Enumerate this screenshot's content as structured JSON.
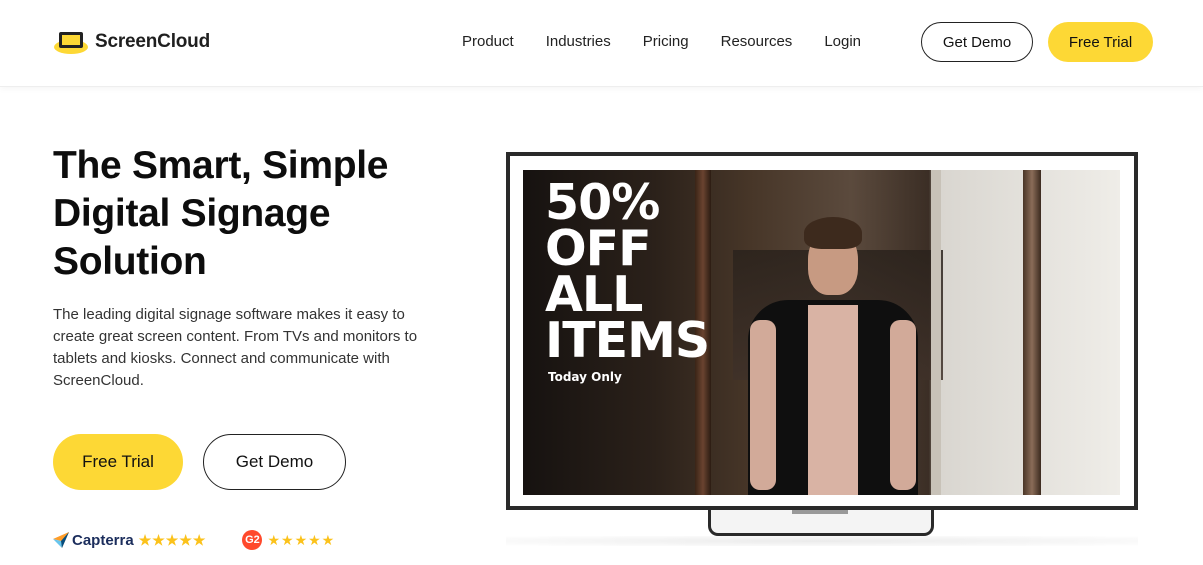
{
  "brand": {
    "name": "ScreenCloud"
  },
  "nav": {
    "links": [
      "Product",
      "Industries",
      "Pricing",
      "Resources",
      "Login"
    ],
    "get_demo": "Get Demo",
    "free_trial": "Free Trial"
  },
  "hero": {
    "title": "The Smart, Simple Digital Signage Solution",
    "subtitle": "The leading digital signage software makes it easy to create great screen content. From TVs and monitors to tablets and kiosks. Connect and communicate with ScreenCloud.",
    "free_trial": "Free Trial",
    "get_demo": "Get Demo"
  },
  "tv_screen": {
    "promo_lines": [
      "50%",
      "OFF",
      "ALL",
      "ITEMS"
    ],
    "promo_sub": "Today Only"
  },
  "ratings": {
    "capterra_label": "Capterra",
    "capterra_stars": "★★★★★",
    "g2_badge": "G2",
    "g2_stars": "★★★★★"
  },
  "colors": {
    "accent": "#fdd835",
    "text": "#111111",
    "capterra": "#1b2d5c",
    "g2": "#ff492c"
  }
}
